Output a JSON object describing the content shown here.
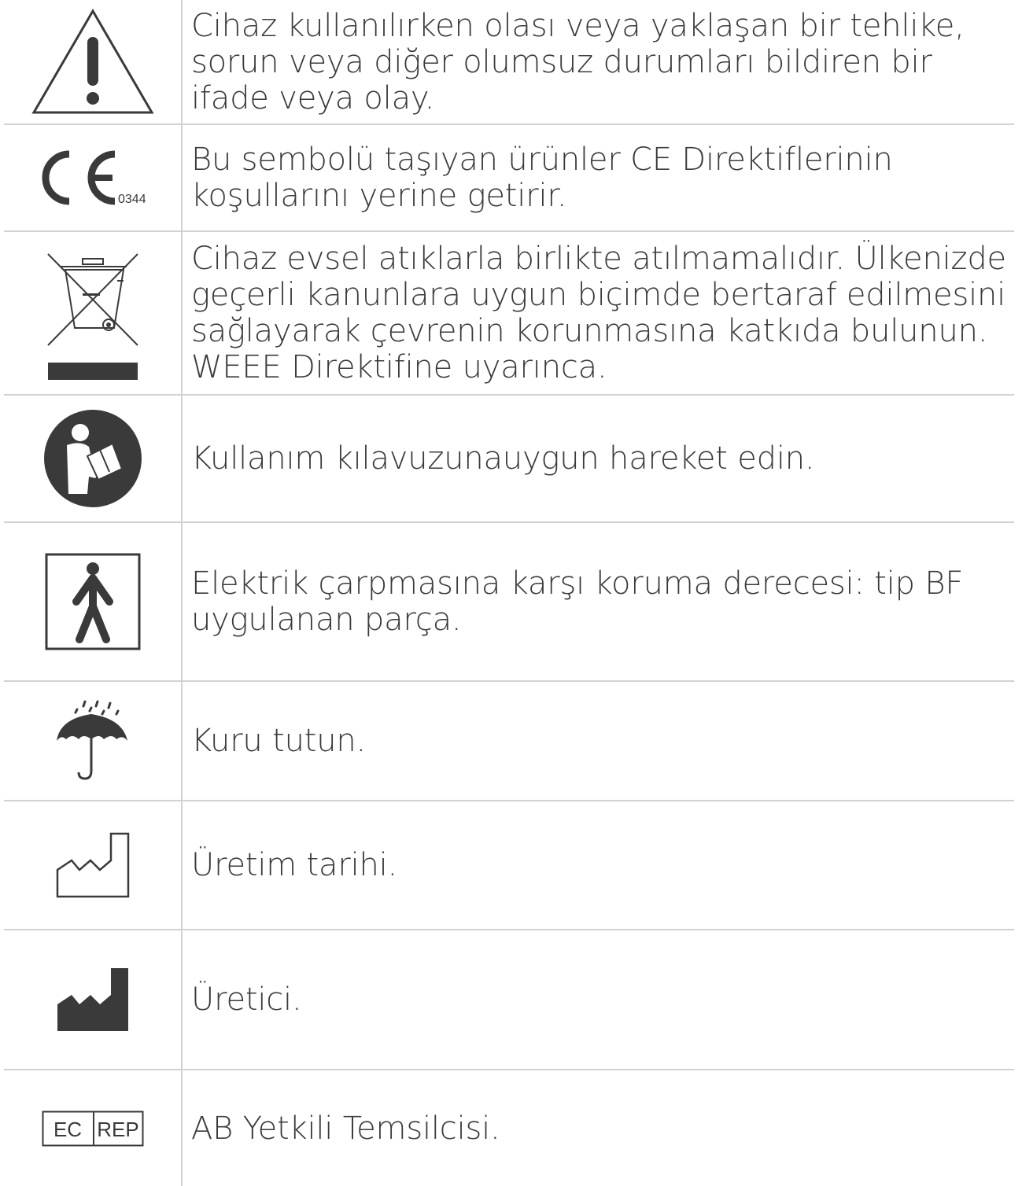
{
  "rows": [
    {
      "icon": "warning-triangle-icon",
      "text": "Cihaz kullanılırken olası veya yaklaşan bir tehlike, sorun veya diğer olumsuz durumları bildiren bir ifade veya olay."
    },
    {
      "icon": "ce-mark-icon",
      "ce_number": "0344",
      "text": "Bu sembolü taşıyan ürünler CE Direktiflerinin koşullarını yerine getirir."
    },
    {
      "icon": "weee-crossed-bin-icon",
      "text": "Cihaz evsel atıklarla birlikte atılmamalıdır. Ülkenizde geçerli kanunlara uygun biçimde bertaraf edilmesini sağlayarak çevrenin korunmasına katkıda bulunun. WEEE Direktifine uyarınca."
    },
    {
      "icon": "read-manual-icon",
      "text": "Kullanım kılavuzunauygun hareket edin."
    },
    {
      "icon": "type-bf-applied-part-icon",
      "text": "Elektrik çarpmasına karşı koruma derecesi: tip BF uygulanan parça."
    },
    {
      "icon": "keep-dry-umbrella-icon",
      "text": "Kuru tutun."
    },
    {
      "icon": "date-of-manufacture-icon",
      "text": "Üretim tarihi."
    },
    {
      "icon": "manufacturer-icon",
      "text": "Üretici."
    },
    {
      "icon": "ec-rep-icon",
      "ec_label": "EC",
      "rep_label": "REP",
      "text": "AB Yetkili Temsilcisi."
    }
  ],
  "colors": {
    "icon_dark": "#3a3a3a",
    "border": "#d2d2d2",
    "text": "#3a3a3a"
  }
}
